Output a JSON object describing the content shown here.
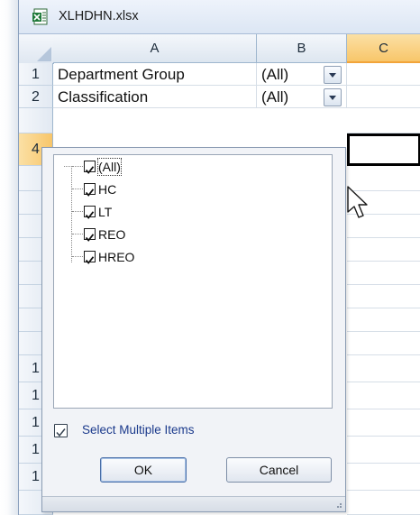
{
  "window": {
    "title": "XLHDHN.xlsx",
    "file_icon": "excel-file-icon"
  },
  "sheet": {
    "columns": [
      "A",
      "B",
      "C"
    ],
    "active_column": "C",
    "rows": [
      {
        "num": "1",
        "a": "Department Group",
        "b": "(All)",
        "filter": true
      },
      {
        "num": "2",
        "a": "Classification",
        "b": "(All)",
        "filter": true
      }
    ],
    "row_stubs": [
      "4",
      "1",
      "1",
      "1",
      "1",
      "1"
    ]
  },
  "filter_popup": {
    "items": [
      {
        "label": "(All)",
        "checked": true
      },
      {
        "label": "HC",
        "checked": true
      },
      {
        "label": "LT",
        "checked": true
      },
      {
        "label": "REO",
        "checked": true
      },
      {
        "label": "HREO",
        "checked": true
      }
    ],
    "select_multiple": {
      "label": "Select Multiple Items",
      "checked": true
    },
    "ok_label": "OK",
    "cancel_label": "Cancel"
  },
  "colors": {
    "accent": "#f8c66a",
    "link_text": "#1b3a8c",
    "header_blue": "#dce6f4"
  }
}
